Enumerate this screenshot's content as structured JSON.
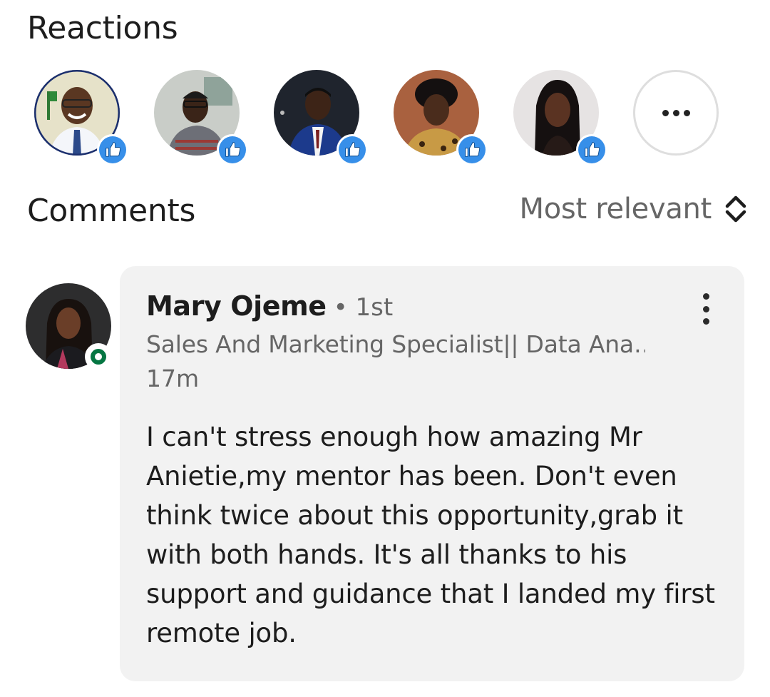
{
  "reactions": {
    "title": "Reactions",
    "reaction_type": "like",
    "reactors": [
      {
        "name": "reactor-1",
        "avatar_bg": "#e6e2c9"
      },
      {
        "name": "reactor-2",
        "avatar_bg": "#cfd3cf"
      },
      {
        "name": "reactor-3",
        "avatar_bg": "#222833"
      },
      {
        "name": "reactor-4",
        "avatar_bg": "#b06a4a"
      },
      {
        "name": "reactor-5",
        "avatar_bg": "#e7e4e4"
      }
    ],
    "more_icon": "more-horizontal-icon"
  },
  "comments": {
    "title": "Comments",
    "sort_label": "Most relevant",
    "sort_icon": "sort-updown-icon",
    "items": [
      {
        "author": "Mary Ojeme",
        "degree": "• 1st",
        "headline": "Sales And Marketing Specialist|| Data Ana…",
        "time": "17m",
        "online": true,
        "text": "I can't stress enough how amazing Mr Anietie,my mentor has been. Don't even think twice about this opportunity,grab it with both hands. It's all thanks to his support and guidance that I landed my first remote job."
      }
    ]
  },
  "colors": {
    "like_blue": "#378fe9",
    "online_green": "#057642",
    "card_bg": "#f2f2f2",
    "secondary_text": "#666666"
  }
}
